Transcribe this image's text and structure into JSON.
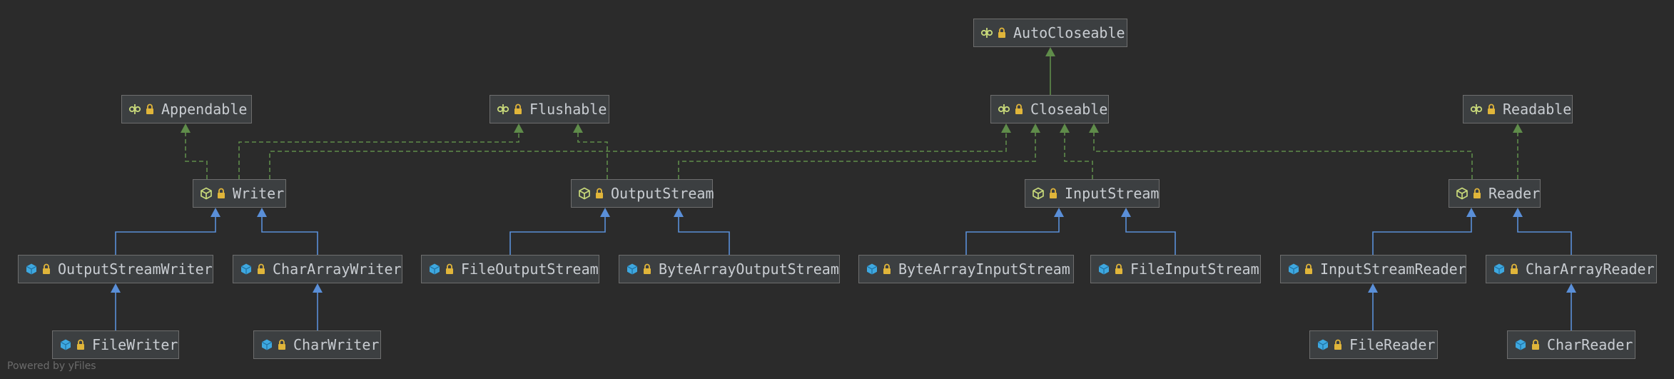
{
  "colors": {
    "background": "#2b2b2b",
    "implements_edge": "#5f8c4a",
    "extends_edge": "#5a8fd8",
    "interface_icon": "#c8d97a",
    "abstract_icon": "#c8d97a",
    "class_icon": "#3ea8e0"
  },
  "nodes": [
    {
      "id": "autocloseable",
      "label": "AutoCloseable",
      "kind": "interface"
    },
    {
      "id": "appendable",
      "label": "Appendable",
      "kind": "interface"
    },
    {
      "id": "flushable",
      "label": "Flushable",
      "kind": "interface"
    },
    {
      "id": "closeable",
      "label": "Closeable",
      "kind": "interface"
    },
    {
      "id": "readable",
      "label": "Readable",
      "kind": "interface"
    },
    {
      "id": "writer",
      "label": "Writer",
      "kind": "abstract"
    },
    {
      "id": "outputstream",
      "label": "OutputStream",
      "kind": "abstract"
    },
    {
      "id": "inputstream",
      "label": "InputStream",
      "kind": "abstract"
    },
    {
      "id": "reader",
      "label": "Reader",
      "kind": "abstract"
    },
    {
      "id": "outputstreamwriter",
      "label": "OutputStreamWriter",
      "kind": "class"
    },
    {
      "id": "chararraywriter",
      "label": "CharArrayWriter",
      "kind": "class"
    },
    {
      "id": "fileoutputstream",
      "label": "FileOutputStream",
      "kind": "class"
    },
    {
      "id": "bytearrayoutputstream",
      "label": "ByteArrayOutputStream",
      "kind": "class"
    },
    {
      "id": "bytearrayinputstream",
      "label": "ByteArrayInputStream",
      "kind": "class"
    },
    {
      "id": "fileinputstream",
      "label": "FileInputStream",
      "kind": "class"
    },
    {
      "id": "inputstreamreader",
      "label": "InputStreamReader",
      "kind": "class"
    },
    {
      "id": "chararrayreader",
      "label": "CharArrayReader",
      "kind": "class"
    },
    {
      "id": "filewriter",
      "label": "FileWriter",
      "kind": "class"
    },
    {
      "id": "charwriter",
      "label": "CharWriter",
      "kind": "class"
    },
    {
      "id": "filereader",
      "label": "FileReader",
      "kind": "class"
    },
    {
      "id": "charreader",
      "label": "CharReader",
      "kind": "class"
    }
  ],
  "edges": [
    {
      "from": "closeable",
      "to": "autocloseable",
      "type": "extends-interface"
    },
    {
      "from": "writer",
      "to": "appendable",
      "type": "implements"
    },
    {
      "from": "writer",
      "to": "flushable",
      "type": "implements"
    },
    {
      "from": "writer",
      "to": "closeable",
      "type": "implements"
    },
    {
      "from": "outputstream",
      "to": "flushable",
      "type": "implements"
    },
    {
      "from": "outputstream",
      "to": "closeable",
      "type": "implements"
    },
    {
      "from": "inputstream",
      "to": "closeable",
      "type": "implements"
    },
    {
      "from": "reader",
      "to": "closeable",
      "type": "implements"
    },
    {
      "from": "reader",
      "to": "readable",
      "type": "implements"
    },
    {
      "from": "outputstreamwriter",
      "to": "writer",
      "type": "extends"
    },
    {
      "from": "chararraywriter",
      "to": "writer",
      "type": "extends"
    },
    {
      "from": "fileoutputstream",
      "to": "outputstream",
      "type": "extends"
    },
    {
      "from": "bytearrayoutputstream",
      "to": "outputstream",
      "type": "extends"
    },
    {
      "from": "bytearrayinputstream",
      "to": "inputstream",
      "type": "extends"
    },
    {
      "from": "fileinputstream",
      "to": "inputstream",
      "type": "extends"
    },
    {
      "from": "inputstreamreader",
      "to": "reader",
      "type": "extends"
    },
    {
      "from": "chararrayreader",
      "to": "reader",
      "type": "extends"
    },
    {
      "from": "filewriter",
      "to": "outputstreamwriter",
      "type": "extends"
    },
    {
      "from": "charwriter",
      "to": "chararraywriter",
      "type": "extends"
    },
    {
      "from": "filereader",
      "to": "inputstreamreader",
      "type": "extends"
    },
    {
      "from": "charreader",
      "to": "chararrayreader",
      "type": "extends"
    }
  ],
  "footer": "Powered by yFiles"
}
